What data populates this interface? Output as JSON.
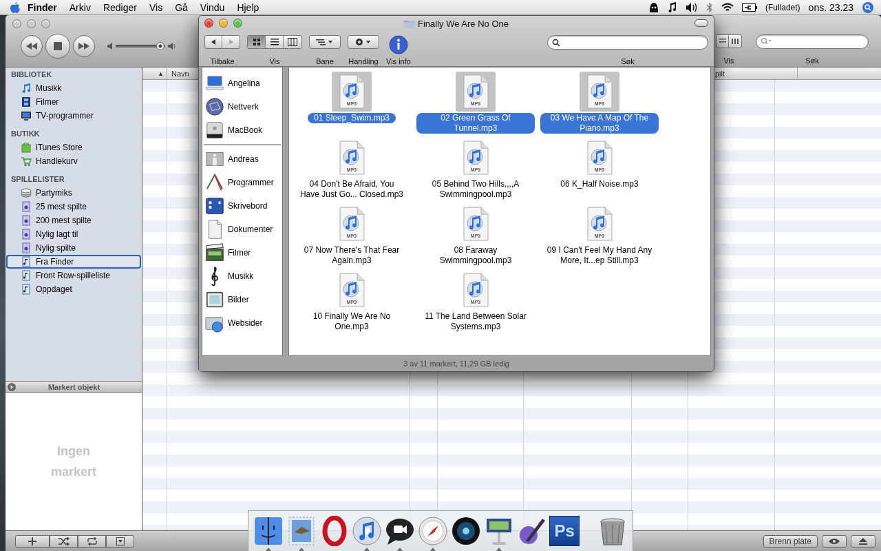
{
  "menubar": {
    "app": "Finder",
    "menus": [
      "Arkiv",
      "Rediger",
      "Vis",
      "Gå",
      "Vindu",
      "Hjelp"
    ],
    "battery": "(Fulladet)",
    "clock": "ons. 23.23"
  },
  "itunes": {
    "volume": {
      "level": 0.9
    },
    "view_label": "Vis",
    "search_label": "Søk",
    "sidebar": [
      {
        "title": "BIBLIOTEK",
        "items": [
          {
            "label": "Musikk",
            "kind": "music",
            "highlighted": false
          },
          {
            "label": "Filmer",
            "kind": "film",
            "highlighted": false
          },
          {
            "label": "TV-programmer",
            "kind": "tv",
            "highlighted": false
          }
        ]
      },
      {
        "title": "BUTIKK",
        "items": [
          {
            "label": "iTunes Store",
            "kind": "store",
            "highlighted": false
          },
          {
            "label": "Handlekurv",
            "kind": "cart",
            "highlighted": false
          }
        ]
      },
      {
        "title": "SPILLELISTER",
        "items": [
          {
            "label": "Partymiks",
            "kind": "party",
            "highlighted": false
          },
          {
            "label": "25 mest spilte",
            "kind": "smart",
            "highlighted": false
          },
          {
            "label": "200 mest spilte",
            "kind": "smart",
            "highlighted": false
          },
          {
            "label": "Nylig lagt til",
            "kind": "smart",
            "highlighted": false
          },
          {
            "label": "Nylig spilte",
            "kind": "smart",
            "highlighted": false
          },
          {
            "label": "Fra Finder",
            "kind": "playlist",
            "highlighted": true
          },
          {
            "label": "Front Row-spilleliste",
            "kind": "playlist",
            "highlighted": false
          },
          {
            "label": "Oppdaget",
            "kind": "playlist",
            "highlighted": false
          }
        ]
      }
    ],
    "sort_arrow": "▲",
    "columns": [
      "Navn",
      "pilt"
    ],
    "info_panel": {
      "title": "Markert objekt",
      "empty_text": "Ingen markert"
    },
    "burn_button": "Brenn plate"
  },
  "finder": {
    "title": "Finally We Are No One",
    "views": [
      {
        "kind": "icons",
        "selected": true
      },
      {
        "kind": "list",
        "selected": false
      },
      {
        "kind": "columns",
        "selected": false
      }
    ],
    "toolbar": [
      {
        "kind": "nav",
        "label": "Tilbake"
      },
      {
        "kind": "view",
        "label": "Vis"
      },
      {
        "kind": "path",
        "label": "Bane"
      },
      {
        "kind": "action",
        "label": "Handling"
      },
      {
        "kind": "info",
        "label": "Vis info"
      }
    ],
    "search_label": "Søk",
    "devices": [
      {
        "label": "Angelina",
        "kind": "laptop"
      },
      {
        "label": "Nettverk",
        "kind": "globe"
      },
      {
        "label": "MacBook",
        "kind": "drive"
      }
    ],
    "places": [
      {
        "label": "Andreas",
        "kind": "house"
      },
      {
        "label": "Programmer",
        "kind": "apps"
      },
      {
        "label": "Skrivebord",
        "kind": "desktop"
      },
      {
        "label": "Dokumenter",
        "kind": "document"
      },
      {
        "label": "Filmer",
        "kind": "movies"
      },
      {
        "label": "Musikk",
        "kind": "musicfolder"
      },
      {
        "label": "Bilder",
        "kind": "pictures"
      },
      {
        "label": "Websider",
        "kind": "sites"
      }
    ],
    "files": [
      {
        "name": "01 Sleep_Swim.mp3",
        "type": "MP3",
        "selected": true
      },
      {
        "name": "02 Green Grass Of Tunnel.mp3",
        "type": "MP3",
        "selected": true
      },
      {
        "name": "03 We Have A Map Of The Piano.mp3",
        "type": "MP3",
        "selected": true
      },
      {
        "name": "04 Don't Be Afraid, You Have Just Go... Closed.mp3",
        "type": "MP3",
        "selected": false
      },
      {
        "name": "05 Behind Two Hills,,,,A Swimmingpool.mp3",
        "type": "MP3",
        "selected": false
      },
      {
        "name": "06 K_Half Noise.mp3",
        "type": "MP3",
        "selected": false
      },
      {
        "name": "07 Now There's That Fear Again.mp3",
        "type": "MP3",
        "selected": false
      },
      {
        "name": "08 Faraway Swimmingpool.mp3",
        "type": "MP3",
        "selected": false
      },
      {
        "name": "09 I Can't Feel My Hand Any More, It...ep Still.mp3",
        "type": "MP3",
        "selected": false
      },
      {
        "name": "10 Finally We Are No One.mp3",
        "type": "MP3",
        "selected": false
      },
      {
        "name": "11 The Land Between Solar Systems.mp3",
        "type": "MP3",
        "selected": false
      }
    ],
    "status": "3 av 11 markert, 11,29 GB ledig"
  },
  "dock": [
    {
      "kind": "finder",
      "running": true
    },
    {
      "kind": "mail",
      "running": true
    },
    {
      "kind": "ring",
      "running": false
    },
    {
      "kind": "disc",
      "running": true
    },
    {
      "kind": "chat",
      "running": true
    },
    {
      "kind": "compass",
      "running": true
    },
    {
      "kind": "lens",
      "running": false
    },
    {
      "kind": "podium",
      "running": true
    },
    {
      "kind": "pen",
      "running": false
    },
    {
      "kind": "tile",
      "label": "Ps",
      "running": false
    },
    {
      "kind": "trash",
      "running": false
    }
  ]
}
